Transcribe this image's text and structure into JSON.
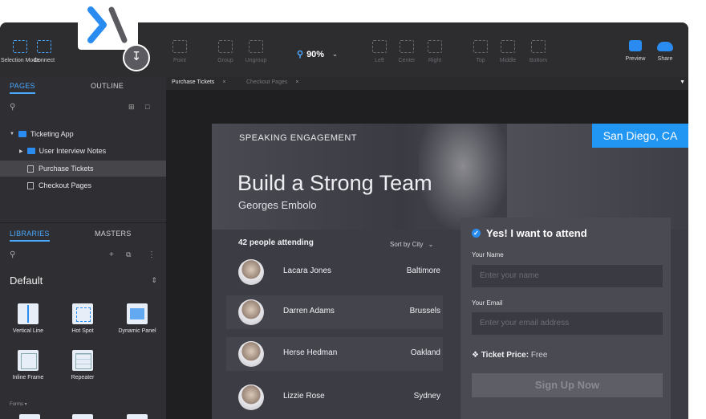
{
  "toolbar": {
    "items": [
      {
        "label": "Selection Mode"
      },
      {
        "label": "Connect"
      },
      {
        "label": "Point"
      },
      {
        "label": "Group"
      },
      {
        "label": "Ungroup"
      },
      {
        "label": "Left"
      },
      {
        "label": "Center"
      },
      {
        "label": "Right"
      },
      {
        "label": "Top"
      },
      {
        "label": "Middle"
      },
      {
        "label": "Bottom"
      },
      {
        "label": "Preview"
      },
      {
        "label": "Share"
      }
    ],
    "zoom": "90%"
  },
  "sidebar": {
    "pages_tab": "PAGES",
    "outline_tab": "OUTLINE",
    "tree": [
      {
        "label": "Ticketing App"
      },
      {
        "label": "User Interview Notes"
      },
      {
        "label": "Purchase Tickets"
      },
      {
        "label": "Checkout Pages"
      }
    ],
    "libraries_tab": "LIBRARIES",
    "masters_tab": "MASTERS",
    "library": "Default",
    "widgets": [
      {
        "label": "Vertical Line"
      },
      {
        "label": "Hot Spot"
      },
      {
        "label": "Dynamic Panel"
      },
      {
        "label": "Inline Frame"
      },
      {
        "label": "Repeater"
      }
    ],
    "forms_label": "Forms ▾"
  },
  "doc_tabs": [
    {
      "label": "Purchase Tickets"
    },
    {
      "label": "Checkout Pages"
    }
  ],
  "design": {
    "eyebrow": "SPEAKING ENGAGEMENT",
    "title": "Build a Strong Team",
    "speaker": "Georges Embolo",
    "city": "San Diego, CA",
    "attending": "42 people attending",
    "sort": "Sort by City",
    "people": [
      {
        "name": "Lacara Jones",
        "city": "Baltimore"
      },
      {
        "name": "Darren Adams",
        "city": "Brussels"
      },
      {
        "name": "Herse Hedman",
        "city": "Oakland"
      },
      {
        "name": "Lizzie Rose",
        "city": "Sydney"
      }
    ],
    "form": {
      "title": "Yes! I want to attend",
      "name_label": "Your Name",
      "name_placeholder": "Enter your name",
      "email_label": "Your Email",
      "email_placeholder": "Enter your email address",
      "price_label": "Ticket Price:",
      "price_value": "Free",
      "button": "Sign Up Now"
    }
  },
  "colors": {
    "accent": "#2196f3",
    "panel": "#2f2f33",
    "canvas": "#3c3c44"
  }
}
